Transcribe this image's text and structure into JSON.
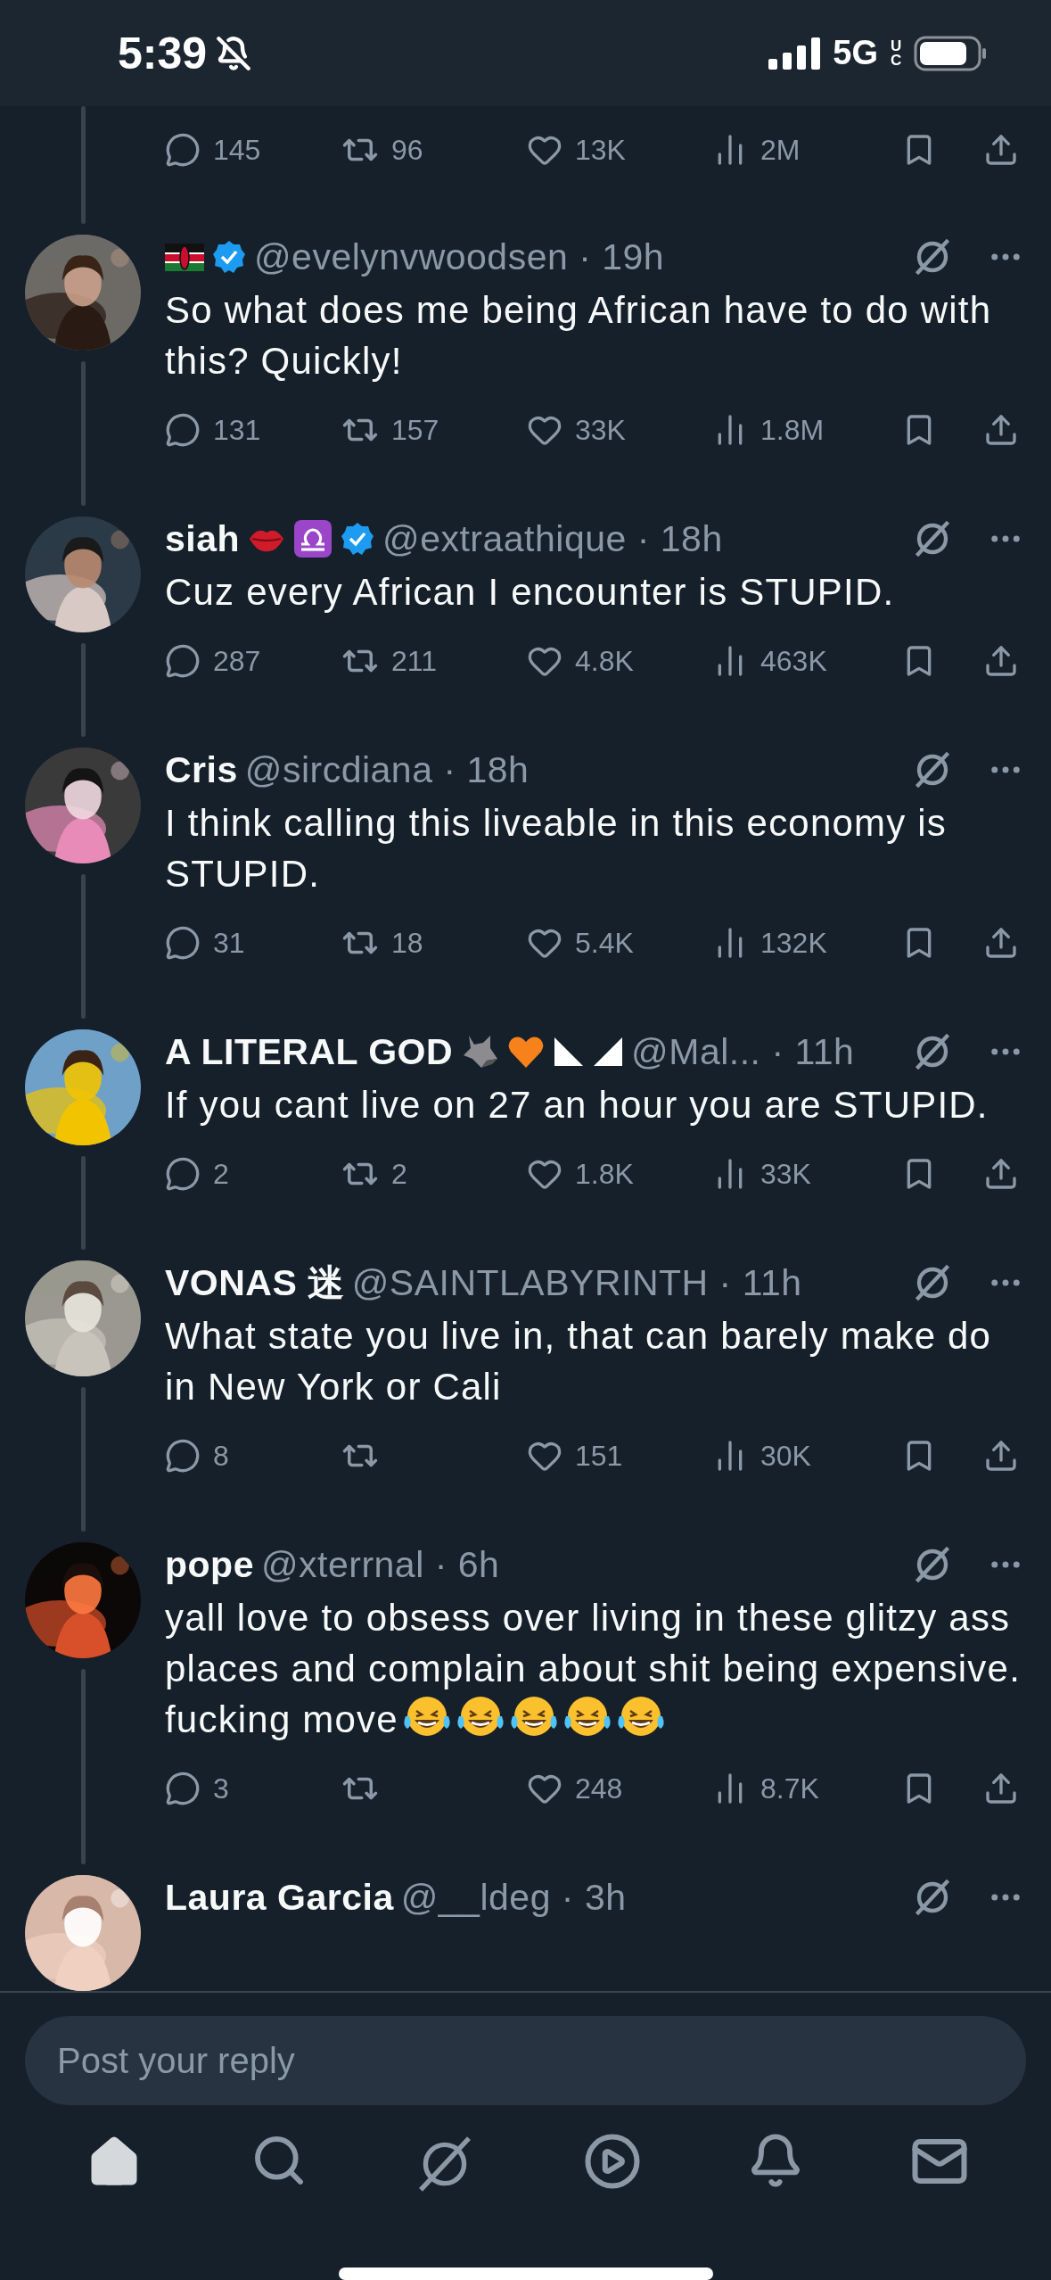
{
  "status_bar": {
    "time": "5:39",
    "network": "5G",
    "network_sub": "UC"
  },
  "separator": "·",
  "previous_actions": {
    "replies": "145",
    "reposts": "96",
    "likes": "13K",
    "views": "2M"
  },
  "replies": [
    {
      "badges": [
        {
          "kind": "flag"
        }
      ],
      "verified": true,
      "handle": "@evelynvwoodsen",
      "time": "19h",
      "text": "So what does me being African have to do with this? Quickly!",
      "replies": "131",
      "reposts": "157",
      "likes": "33K",
      "views": "1.8M"
    },
    {
      "name": "siah",
      "badges": [
        {
          "kind": "lips"
        },
        {
          "kind": "libra"
        }
      ],
      "verified": true,
      "handle": "@extraathique",
      "time": "18h",
      "text": "Cuz every African I encounter is STUPID.",
      "replies": "287",
      "reposts": "211",
      "likes": "4.8K",
      "views": "463K"
    },
    {
      "name": "Cris",
      "handle": "@sircdiana",
      "time": "18h",
      "text": "I think calling this liveable in this economy is STUPID.",
      "replies": "31",
      "reposts": "18",
      "likes": "5.4K",
      "views": "132K"
    },
    {
      "name": "A LITERAL GOD",
      "badges": [
        {
          "kind": "wolf"
        },
        {
          "kind": "heart"
        },
        {
          "kind": "tri-left"
        },
        {
          "kind": "tri-right"
        }
      ],
      "handle": "@Mal...",
      "time": "11h",
      "text": "If you cant live on 27 an hour you are STUPID.",
      "replies": "2",
      "reposts": "2",
      "likes": "1.8K",
      "views": "33K"
    },
    {
      "name": "VONAS 迷",
      "handle": "@SAINTLABYRINTH",
      "time": "11h",
      "text": "What state you live in, that can barely make do in New York or Cali",
      "replies": "8",
      "likes": "151",
      "views": "30K"
    },
    {
      "name": "pope",
      "handle": "@xterrnal",
      "time": "6h",
      "text": "yall love to obsess over living in these glitzy ass places and complain about shit being expensive. fucking move",
      "emoji": [
        {
          "kind": "laugh"
        },
        {
          "kind": "laugh"
        },
        {
          "kind": "laugh"
        },
        {
          "kind": "laugh"
        },
        {
          "kind": "laugh"
        }
      ],
      "replies": "3",
      "likes": "248",
      "views": "8.7K"
    },
    {
      "name": "Laura Garcia",
      "handle": "@__ldeg",
      "time": "3h"
    }
  ],
  "composer": {
    "placeholder": "Post your reply"
  },
  "nav": [
    {
      "kind": "home",
      "selected": true
    },
    {
      "kind": "search",
      "selected": false
    },
    {
      "kind": "grok",
      "selected": false
    },
    {
      "kind": "play",
      "selected": false
    },
    {
      "kind": "bell",
      "selected": false
    },
    {
      "kind": "mail",
      "selected": false
    }
  ]
}
